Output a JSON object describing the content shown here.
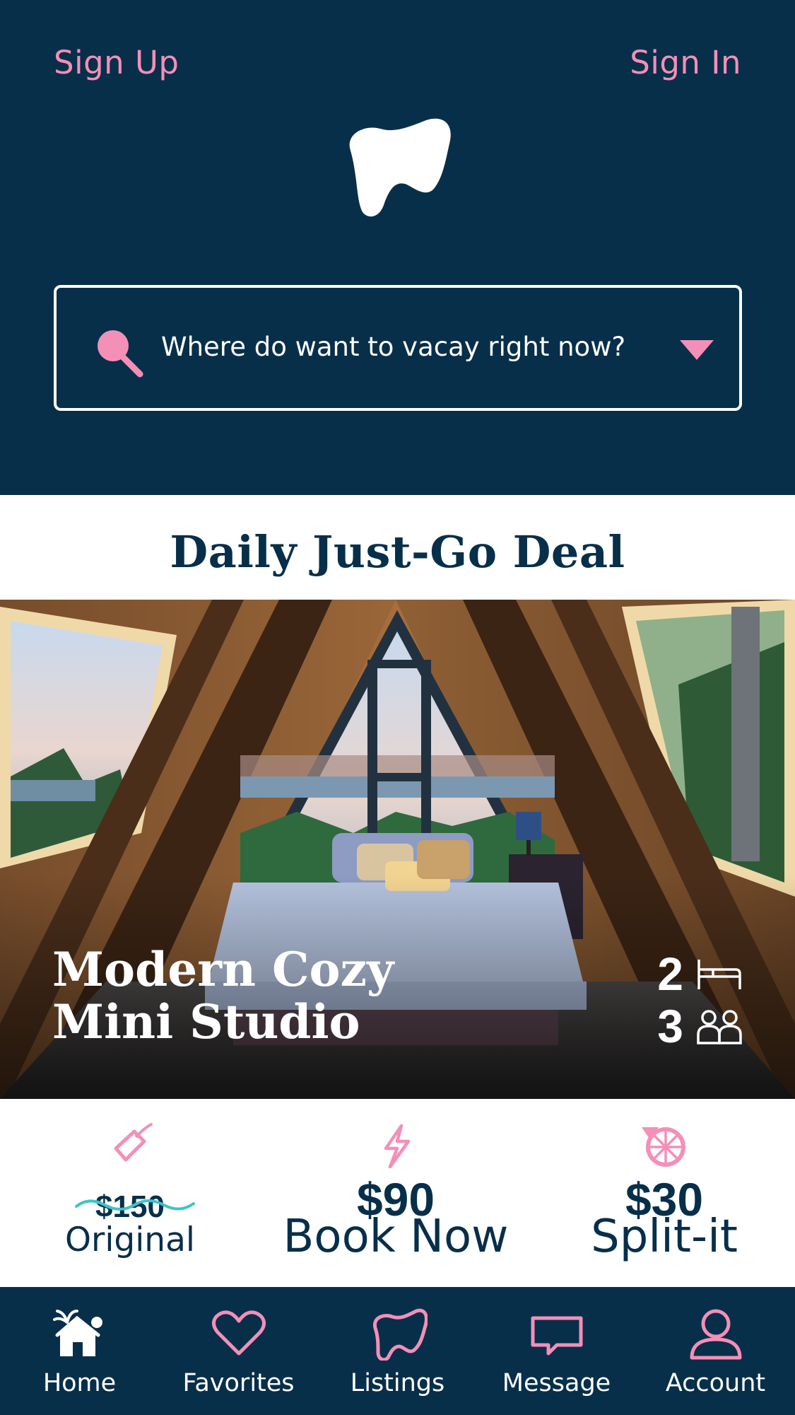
{
  "header": {
    "sign_up": "Sign Up",
    "sign_in": "Sign In",
    "logo_icon": "tooth-shaped-logo",
    "search": {
      "placeholder": "Where do want to vacay right now?",
      "icon": "search-icon",
      "dropdown_icon": "chevron-down-icon"
    }
  },
  "deal": {
    "title": "Daily Just-Go Deal"
  },
  "listing": {
    "name_line1": "Modern Cozy",
    "name_line2": "Mini Studio",
    "beds": "2",
    "guests": "3",
    "beds_icon": "bed-icon",
    "guests_icon": "guests-icon"
  },
  "pricing": {
    "original": {
      "amount": "$150",
      "label": "Original",
      "icon": "price-tag-icon"
    },
    "book": {
      "amount": "$90",
      "label": "Book Now",
      "icon": "lightning-icon"
    },
    "split": {
      "amount": "$30",
      "label": "Split-it",
      "icon": "pie-split-icon"
    }
  },
  "tabs": [
    {
      "label": "Home",
      "icon": "home-icon",
      "active": true
    },
    {
      "label": "Favorites",
      "icon": "heart-icon",
      "active": false
    },
    {
      "label": "Listings",
      "icon": "listings-icon",
      "active": false
    },
    {
      "label": "Message",
      "icon": "message-icon",
      "active": false
    },
    {
      "label": "Account",
      "icon": "account-icon",
      "active": false
    }
  ],
  "colors": {
    "navy": "#072f4a",
    "pink": "#f48fb8",
    "teal": "#3cc5c8",
    "white": "#ffffff"
  }
}
